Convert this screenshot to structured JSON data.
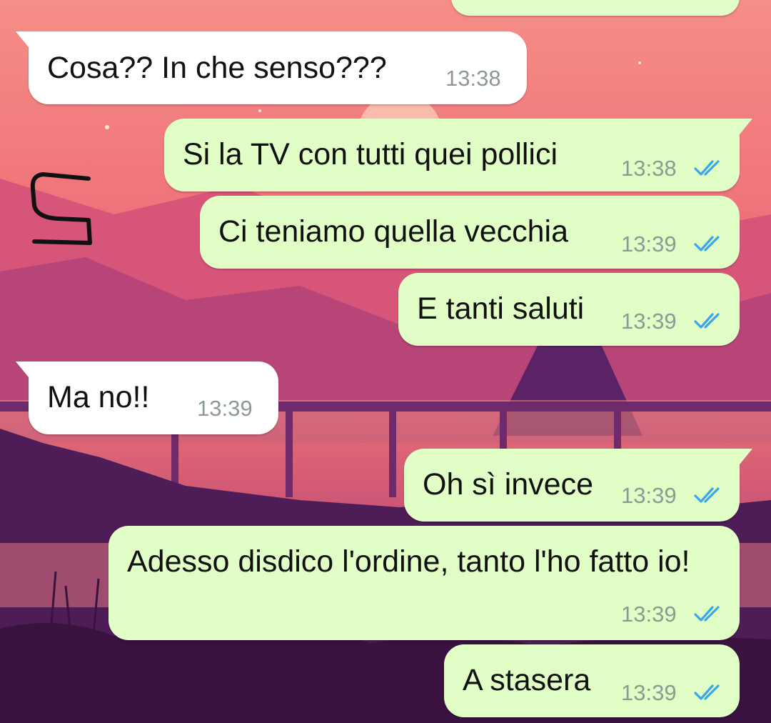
{
  "wallpaper": {
    "sky_top": "#f28a8a",
    "sky_mid": "#e85a6e",
    "mountains": "#b8457a",
    "ground": "#5a2160"
  },
  "colors": {
    "incoming_bubble": "#ffffff",
    "outgoing_bubble": "#e1fec6",
    "read_ticks": "#3aa6e8",
    "timestamp": "#8d9a94"
  },
  "messages": [
    {
      "dir": "out",
      "text": "",
      "time": "",
      "read": false,
      "partial": true
    },
    {
      "dir": "in",
      "text": "Cosa?? In che senso???",
      "time": "13:38"
    },
    {
      "dir": "out",
      "text": "Si la TV con tutti quei pollici",
      "time": "13:38",
      "read": true
    },
    {
      "dir": "out",
      "text": "Ci teniamo quella vecchia",
      "time": "13:39",
      "read": true
    },
    {
      "dir": "out",
      "text": "E tanti saluti",
      "time": "13:39",
      "read": true
    },
    {
      "dir": "in",
      "text": "Ma no!!",
      "time": "13:39"
    },
    {
      "dir": "out",
      "text": "Oh sì invece",
      "time": "13:39",
      "read": true
    },
    {
      "dir": "out",
      "text": "Adesso disdico l'ordine, tanto l'ho fatto io!",
      "time": "13:39",
      "read": true
    },
    {
      "dir": "out",
      "text": "A stasera",
      "time": "13:39",
      "read": true
    }
  ],
  "annotation": {
    "type": "handwritten-doodle",
    "icon": "handwritten-mark-icon"
  }
}
